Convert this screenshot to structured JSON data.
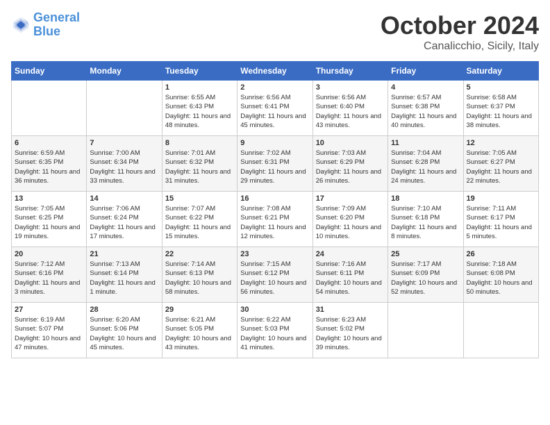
{
  "header": {
    "logo_line1": "General",
    "logo_line2": "Blue",
    "month": "October 2024",
    "location": "Canalicchio, Sicily, Italy"
  },
  "days_of_week": [
    "Sunday",
    "Monday",
    "Tuesday",
    "Wednesday",
    "Thursday",
    "Friday",
    "Saturday"
  ],
  "weeks": [
    [
      {
        "day": "",
        "content": ""
      },
      {
        "day": "",
        "content": ""
      },
      {
        "day": "1",
        "content": "Sunrise: 6:55 AM\nSunset: 6:43 PM\nDaylight: 11 hours and 48 minutes."
      },
      {
        "day": "2",
        "content": "Sunrise: 6:56 AM\nSunset: 6:41 PM\nDaylight: 11 hours and 45 minutes."
      },
      {
        "day": "3",
        "content": "Sunrise: 6:56 AM\nSunset: 6:40 PM\nDaylight: 11 hours and 43 minutes."
      },
      {
        "day": "4",
        "content": "Sunrise: 6:57 AM\nSunset: 6:38 PM\nDaylight: 11 hours and 40 minutes."
      },
      {
        "day": "5",
        "content": "Sunrise: 6:58 AM\nSunset: 6:37 PM\nDaylight: 11 hours and 38 minutes."
      }
    ],
    [
      {
        "day": "6",
        "content": "Sunrise: 6:59 AM\nSunset: 6:35 PM\nDaylight: 11 hours and 36 minutes."
      },
      {
        "day": "7",
        "content": "Sunrise: 7:00 AM\nSunset: 6:34 PM\nDaylight: 11 hours and 33 minutes."
      },
      {
        "day": "8",
        "content": "Sunrise: 7:01 AM\nSunset: 6:32 PM\nDaylight: 11 hours and 31 minutes."
      },
      {
        "day": "9",
        "content": "Sunrise: 7:02 AM\nSunset: 6:31 PM\nDaylight: 11 hours and 29 minutes."
      },
      {
        "day": "10",
        "content": "Sunrise: 7:03 AM\nSunset: 6:29 PM\nDaylight: 11 hours and 26 minutes."
      },
      {
        "day": "11",
        "content": "Sunrise: 7:04 AM\nSunset: 6:28 PM\nDaylight: 11 hours and 24 minutes."
      },
      {
        "day": "12",
        "content": "Sunrise: 7:05 AM\nSunset: 6:27 PM\nDaylight: 11 hours and 22 minutes."
      }
    ],
    [
      {
        "day": "13",
        "content": "Sunrise: 7:05 AM\nSunset: 6:25 PM\nDaylight: 11 hours and 19 minutes."
      },
      {
        "day": "14",
        "content": "Sunrise: 7:06 AM\nSunset: 6:24 PM\nDaylight: 11 hours and 17 minutes."
      },
      {
        "day": "15",
        "content": "Sunrise: 7:07 AM\nSunset: 6:22 PM\nDaylight: 11 hours and 15 minutes."
      },
      {
        "day": "16",
        "content": "Sunrise: 7:08 AM\nSunset: 6:21 PM\nDaylight: 11 hours and 12 minutes."
      },
      {
        "day": "17",
        "content": "Sunrise: 7:09 AM\nSunset: 6:20 PM\nDaylight: 11 hours and 10 minutes."
      },
      {
        "day": "18",
        "content": "Sunrise: 7:10 AM\nSunset: 6:18 PM\nDaylight: 11 hours and 8 minutes."
      },
      {
        "day": "19",
        "content": "Sunrise: 7:11 AM\nSunset: 6:17 PM\nDaylight: 11 hours and 5 minutes."
      }
    ],
    [
      {
        "day": "20",
        "content": "Sunrise: 7:12 AM\nSunset: 6:16 PM\nDaylight: 11 hours and 3 minutes."
      },
      {
        "day": "21",
        "content": "Sunrise: 7:13 AM\nSunset: 6:14 PM\nDaylight: 11 hours and 1 minute."
      },
      {
        "day": "22",
        "content": "Sunrise: 7:14 AM\nSunset: 6:13 PM\nDaylight: 10 hours and 58 minutes."
      },
      {
        "day": "23",
        "content": "Sunrise: 7:15 AM\nSunset: 6:12 PM\nDaylight: 10 hours and 56 minutes."
      },
      {
        "day": "24",
        "content": "Sunrise: 7:16 AM\nSunset: 6:11 PM\nDaylight: 10 hours and 54 minutes."
      },
      {
        "day": "25",
        "content": "Sunrise: 7:17 AM\nSunset: 6:09 PM\nDaylight: 10 hours and 52 minutes."
      },
      {
        "day": "26",
        "content": "Sunrise: 7:18 AM\nSunset: 6:08 PM\nDaylight: 10 hours and 50 minutes."
      }
    ],
    [
      {
        "day": "27",
        "content": "Sunrise: 6:19 AM\nSunset: 5:07 PM\nDaylight: 10 hours and 47 minutes."
      },
      {
        "day": "28",
        "content": "Sunrise: 6:20 AM\nSunset: 5:06 PM\nDaylight: 10 hours and 45 minutes."
      },
      {
        "day": "29",
        "content": "Sunrise: 6:21 AM\nSunset: 5:05 PM\nDaylight: 10 hours and 43 minutes."
      },
      {
        "day": "30",
        "content": "Sunrise: 6:22 AM\nSunset: 5:03 PM\nDaylight: 10 hours and 41 minutes."
      },
      {
        "day": "31",
        "content": "Sunrise: 6:23 AM\nSunset: 5:02 PM\nDaylight: 10 hours and 39 minutes."
      },
      {
        "day": "",
        "content": ""
      },
      {
        "day": "",
        "content": ""
      }
    ]
  ]
}
